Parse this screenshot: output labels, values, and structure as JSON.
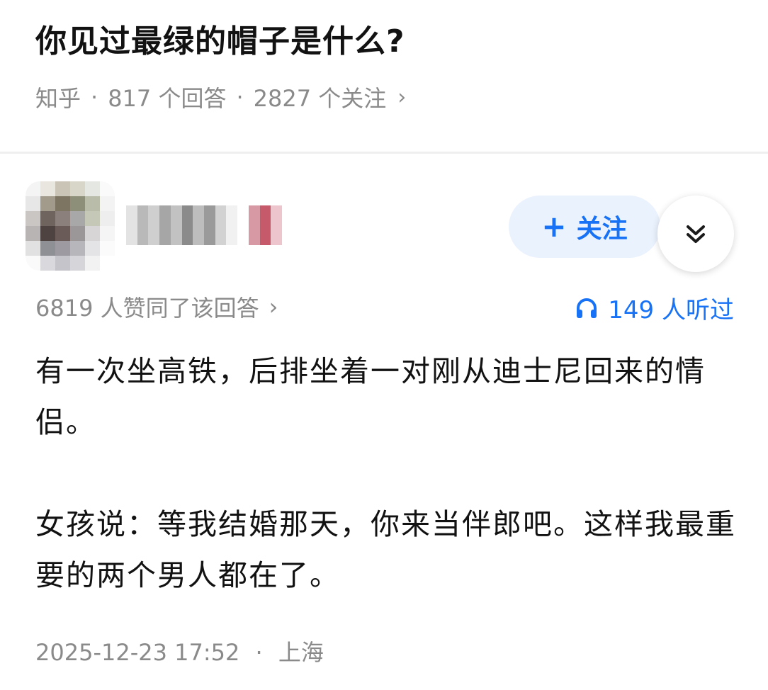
{
  "question": {
    "title": "你见过最绿的帽子是什么?",
    "source": "知乎",
    "answers": "817 个回答",
    "followers": "2827 个关注"
  },
  "author": {
    "follow_label": "关注"
  },
  "stats": {
    "votes": "6819 人赞同了该回答",
    "listened": "149 人听过"
  },
  "answer": {
    "paragraphs": [
      "有一次坐高铁，后排坐着一对刚从迪士尼回来的情侣。",
      "女孩说：等我结婚那天，你来当伴郎吧。这样我最重要的两个男人都在了。"
    ],
    "date": "2025-12-23 17:52",
    "location": "上海"
  },
  "colors": {
    "accent": "#1772f6",
    "follow_bg": "#eaf2fe",
    "muted_text": "#8a8a8a"
  },
  "icons": {
    "expand": "double-chevron-down-icon",
    "listen": "headphones-icon",
    "meta_arrow": "chevron-right-icon"
  }
}
